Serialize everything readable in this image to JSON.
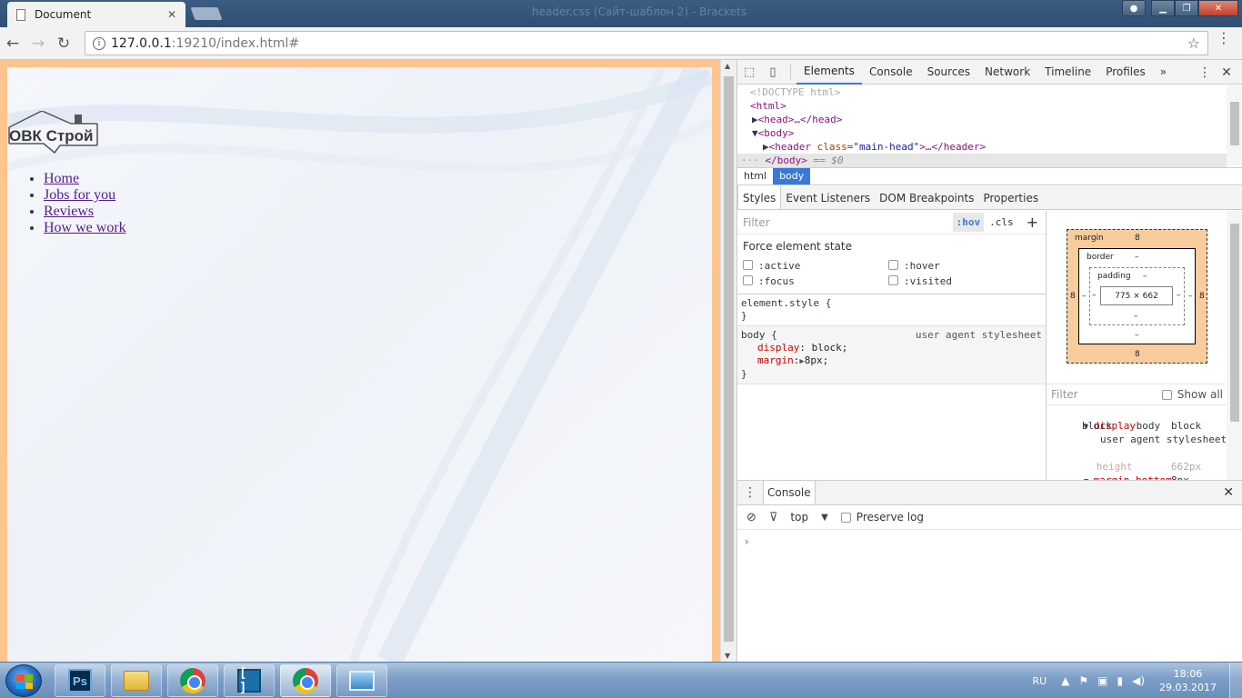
{
  "browser": {
    "tab_title": "Document",
    "tab_close": "✕",
    "window_title": "header.css (Сайт-шаблон 2) - Brackets",
    "url_host": "127.0.0.1",
    "url_rest": ":19210/index.html#"
  },
  "page": {
    "logo_text": "ОВК Строй",
    "nav": [
      "Home",
      "Jobs for you",
      "Reviews",
      "How we work"
    ]
  },
  "devtools": {
    "tabs": [
      "Elements",
      "Console",
      "Sources",
      "Network",
      "Timeline",
      "Profiles"
    ],
    "active_tab": "Elements",
    "more_tabs": "»",
    "dom": {
      "doctype": "<!DOCTYPE html>",
      "html_open": "<html>",
      "head": "<head>…</head>",
      "body_open": "<body>",
      "header_tag": "header",
      "header_attr": "class",
      "header_val": "\"main-head\"",
      "header_close": "…</header>",
      "body_close": "</body>",
      "selected_marker": "== $0"
    },
    "breadcrumbs": [
      "html",
      "body"
    ],
    "sub_tabs": [
      "Styles",
      "Event Listeners",
      "DOM Breakpoints",
      "Properties"
    ],
    "styles": {
      "filter_placeholder": "Filter",
      "hov": ":hov",
      "cls": ".cls",
      "plus": "+",
      "force_title": "Force element state",
      "states": [
        ":active",
        ":hover",
        ":focus",
        ":visited"
      ],
      "element_style_open": "element.style {",
      "close_brace": "}",
      "body_selector": "body {",
      "ua_source": "user agent stylesheet",
      "body_props": [
        {
          "name": "display",
          "value": "block;"
        },
        {
          "name": "margin",
          "value": "8px;"
        }
      ]
    },
    "box_model": {
      "margin_label": "margin",
      "border_label": "border",
      "padding_label": "padding",
      "margin_top": "8",
      "margin_bottom": "8",
      "margin_left": "8",
      "margin_right": "8",
      "border_top": "–",
      "border_bottom": "–",
      "border_left": "–",
      "border_right": "–",
      "padding_top": "–",
      "padding_bottom": "–",
      "padding_left": "–",
      "padding_right": "–",
      "content": "775 × 662"
    },
    "computed": {
      "filter_placeholder": "Filter",
      "show_all": "Show all",
      "rows": [
        {
          "name": "display",
          "value": "block"
        },
        {
          "name": "",
          "value": "block    body"
        },
        {
          "name": "",
          "value": "user agent stylesheet"
        },
        {
          "name": "height",
          "value": "662px"
        },
        {
          "name": "margin-bottom",
          "value": "8px"
        }
      ]
    },
    "console": {
      "tab": "Console",
      "context": "top",
      "preserve_log": "Preserve log",
      "prompt": "›"
    }
  },
  "taskbar": {
    "lang": "RU",
    "time": "18:06",
    "date": "29.03.2017"
  },
  "colors": {
    "accent": "#3879d9",
    "viewport_margin": "#fcc58e",
    "link_visited": "#551a8b"
  }
}
